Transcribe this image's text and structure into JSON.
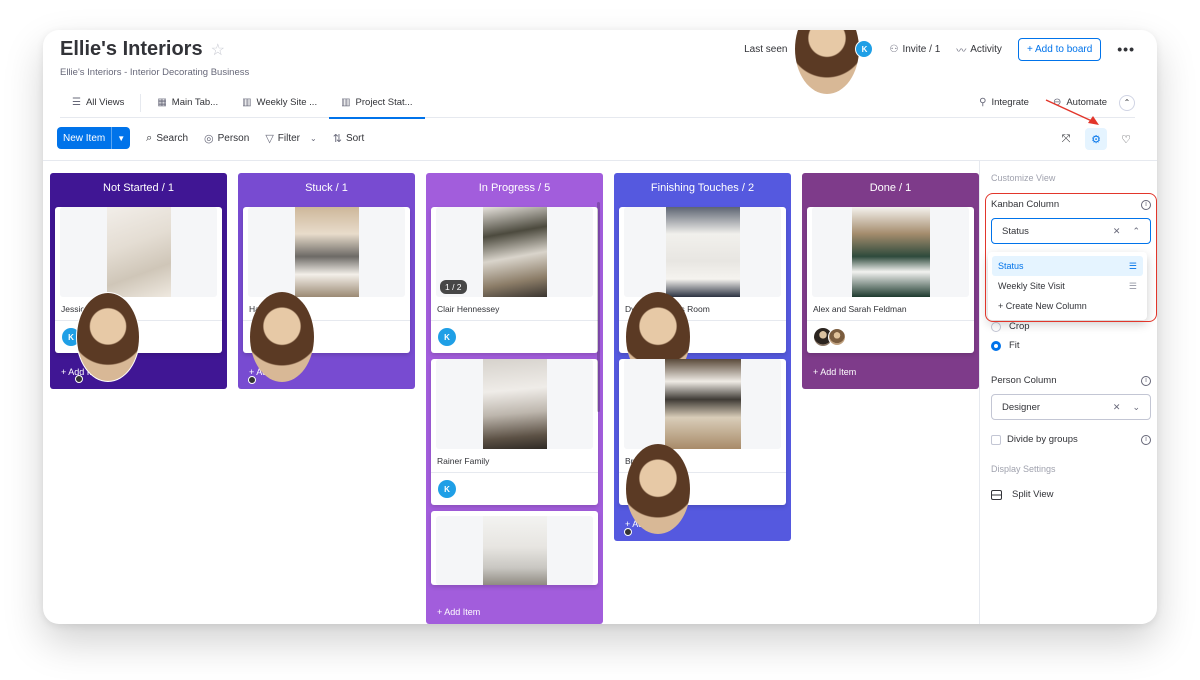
{
  "header": {
    "title": "Ellie's Interiors",
    "subtitle": "Ellie's Interiors - Interior Decorating Business",
    "last_seen_label": "Last seen",
    "last_seen_avatars": [
      "photo",
      "K"
    ],
    "invite_label": "Invite / 1",
    "activity_label": "Activity",
    "add_to_board_label": "+ Add to board",
    "more_label": "•••"
  },
  "tabs": [
    {
      "label": "All Views",
      "icon": "menu-icon"
    },
    {
      "label": "Main Tab...",
      "icon": "table-icon"
    },
    {
      "label": "Weekly Site ...",
      "icon": "kanban-icon"
    },
    {
      "label": "Project Stat...",
      "icon": "kanban-icon",
      "active": true
    }
  ],
  "tab_actions": {
    "integrate": "Integrate",
    "automate": "Automate"
  },
  "toolbar": {
    "new_item": "New Item",
    "search": "Search",
    "person": "Person",
    "filter": "Filter",
    "sort": "Sort"
  },
  "columns": [
    {
      "title": "Not Started / 1",
      "color": "#401694",
      "add_label": "+ Add Item",
      "cards": [
        {
          "name": "Jessica's Room",
          "people": [
            "K",
            "photo"
          ]
        }
      ]
    },
    {
      "title": "Stuck / 1",
      "color": "#784bd1",
      "add_label": "+ Add Item",
      "cards": [
        {
          "name": "Halsey Family",
          "people": [
            "photo"
          ]
        }
      ]
    },
    {
      "title": "In Progress / 5",
      "color": "#a25ddc",
      "add_label": "+ Add Item",
      "cards": [
        {
          "name": "Clair Hennessey",
          "people": [
            "K"
          ],
          "pager": "1 / 2"
        },
        {
          "name": "Rainer Family",
          "people": [
            "K"
          ]
        },
        {
          "name": "",
          "people": []
        }
      ]
    },
    {
      "title": "Finishing Touches / 2",
      "color": "#5559df",
      "add_label": "+ Add Item",
      "cards": [
        {
          "name": "Dylan and Jay's Room",
          "people": [
            "photo"
          ]
        },
        {
          "name": "Brooke Roland",
          "people": [
            "photo"
          ]
        }
      ]
    },
    {
      "title": "Done / 1",
      "color": "#7e3b8a",
      "add_label": "+ Add Item",
      "cards": [
        {
          "name": "Alex and Sarah Feldman",
          "people": [
            "photo2",
            "photo3"
          ]
        }
      ]
    }
  ],
  "panel": {
    "heading": "Customize View",
    "kanban_column_label": "Kanban Column",
    "kanban_column_value": "Status",
    "dropdown_options": [
      {
        "label": "Status",
        "selected": true
      },
      {
        "label": "Weekly Site Visit",
        "selected": false
      },
      {
        "label": "+ Create New Column",
        "selected": false
      }
    ],
    "image_options": [
      {
        "label": "Crop",
        "checked": false
      },
      {
        "label": "Fit",
        "checked": true
      }
    ],
    "person_column_label": "Person Column",
    "person_column_value": "Designer",
    "divide_by_groups_label": "Divide by groups",
    "divide_by_groups_checked": false,
    "display_settings_heading": "Display Settings",
    "split_view_label": "Split View"
  },
  "colors": {
    "primary": "#0073ea",
    "highlight_annotation": "#e2362b"
  }
}
